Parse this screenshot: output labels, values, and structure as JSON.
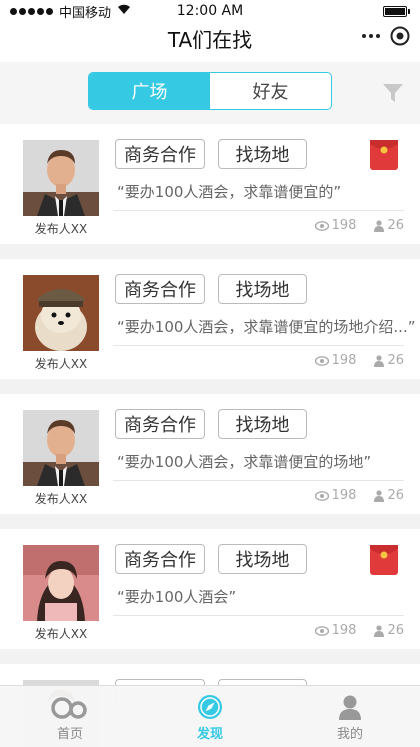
{
  "status_bar": {
    "carrier": "中国移动",
    "time": "12:00 AM"
  },
  "nav": {
    "title": "TA们在找"
  },
  "segment": {
    "tabs": [
      "广场",
      "好友"
    ],
    "active": 0
  },
  "colors": {
    "accent": "#35c9e4",
    "red_packet": "#e03a3a"
  },
  "cards": [
    {
      "tags": [
        "商务合作",
        "找场地"
      ],
      "quote": "“要办100人酒会，求靠谱便宜的”",
      "publisher": "发布人XX",
      "views": "198",
      "people": "26",
      "red_packet": true,
      "avatar": "man-portrait"
    },
    {
      "tags": [
        "商务合作",
        "找场地"
      ],
      "quote": "“要办100人酒会，求靠谱便宜的场地介绍...”",
      "publisher": "发布人XX",
      "views": "198",
      "people": "26",
      "red_packet": false,
      "avatar": "dog-portrait"
    },
    {
      "tags": [
        "商务合作",
        "找场地"
      ],
      "quote": "“要办100人酒会，求靠谱便宜的场地”",
      "publisher": "发布人XX",
      "views": "198",
      "people": "26",
      "red_packet": false,
      "avatar": "man-portrait"
    },
    {
      "tags": [
        "商务合作",
        "找场地"
      ],
      "quote": "“要办100人酒会”",
      "publisher": "发布人XX",
      "views": "198",
      "people": "26",
      "red_packet": true,
      "avatar": "woman-portrait"
    }
  ],
  "tab_bar": {
    "items": [
      "首页",
      "发现",
      "我的"
    ],
    "active": 1
  }
}
